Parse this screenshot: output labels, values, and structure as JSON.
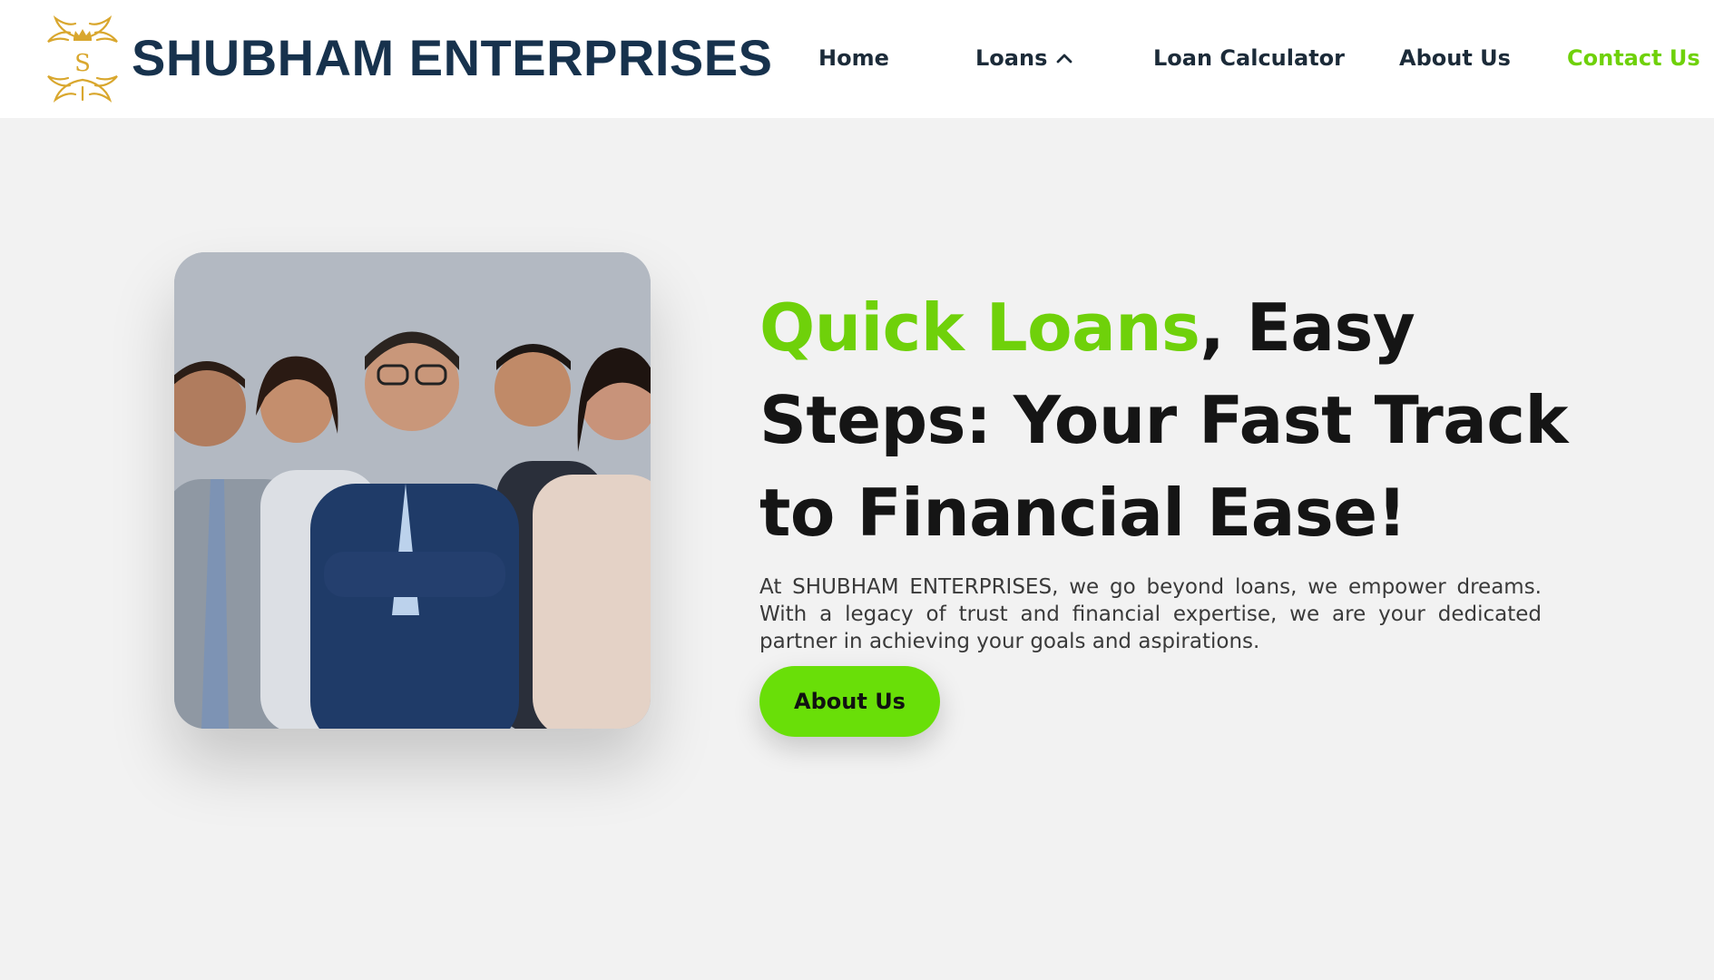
{
  "brand": {
    "name": "SHUBHAM ENTERPRISES",
    "logo_icon": "crown-monogram-icon",
    "logo_letter": "S",
    "color": "#17324d"
  },
  "nav": {
    "home": "Home",
    "loans": "Loans",
    "loan_calculator": "Loan Calculator",
    "about": "About Us",
    "contact": "Contact Us",
    "active_color": "#6fd10a"
  },
  "hero": {
    "headline_accent": "Quick Loans",
    "headline_rest": ", Easy Steps: Your Fast Track to Financial Ease!",
    "intro": "At SHUBHAM ENTERPRISES, we go beyond loans, we empower dreams. With a legacy of trust and financial expertise, we are your dedicated partner in achieving your goals and aspirations.",
    "cta_label": "About Us",
    "accent_color": "#6fd10a",
    "image": "team-of-five-professionals-photo"
  }
}
